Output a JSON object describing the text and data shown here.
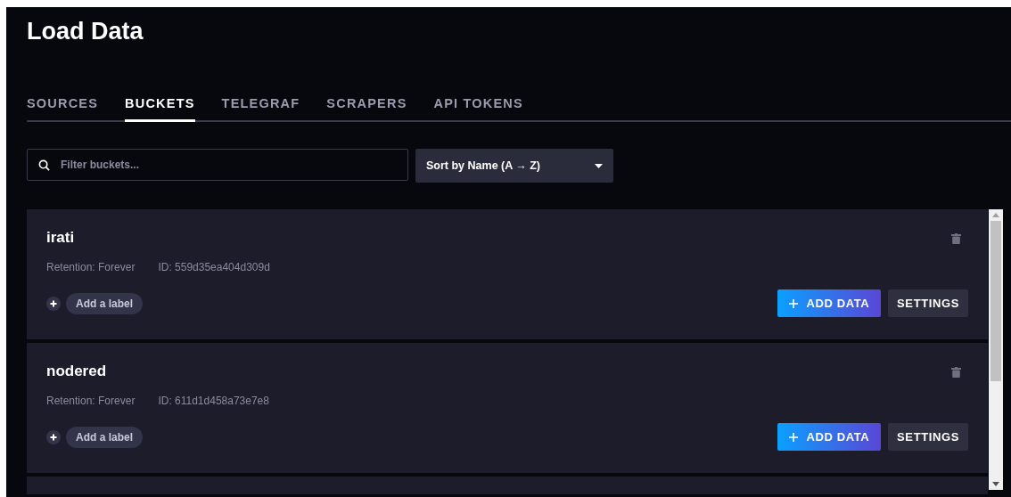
{
  "page": {
    "title": "Load Data"
  },
  "tabs": [
    {
      "label": "SOURCES",
      "selected": false
    },
    {
      "label": "BUCKETS",
      "selected": true
    },
    {
      "label": "TELEGRAF",
      "selected": false
    },
    {
      "label": "SCRAPERS",
      "selected": false
    },
    {
      "label": "API TOKENS",
      "selected": false
    }
  ],
  "search": {
    "placeholder": "Filter buckets..."
  },
  "sort": {
    "value": "Sort by Name (A → Z)"
  },
  "buckets": [
    {
      "name": "irati",
      "retention": "Retention: Forever",
      "id": "ID: 559d35ea404d309d",
      "label_button": "Add a label",
      "add_button": "ADD DATA",
      "settings_button": "SETTINGS"
    },
    {
      "name": "nodered",
      "retention": "Retention: Forever",
      "id": "ID: 611d1d458a73e7e8",
      "label_button": "Add a label",
      "add_button": "ADD DATA",
      "settings_button": "SETTINGS"
    }
  ]
}
